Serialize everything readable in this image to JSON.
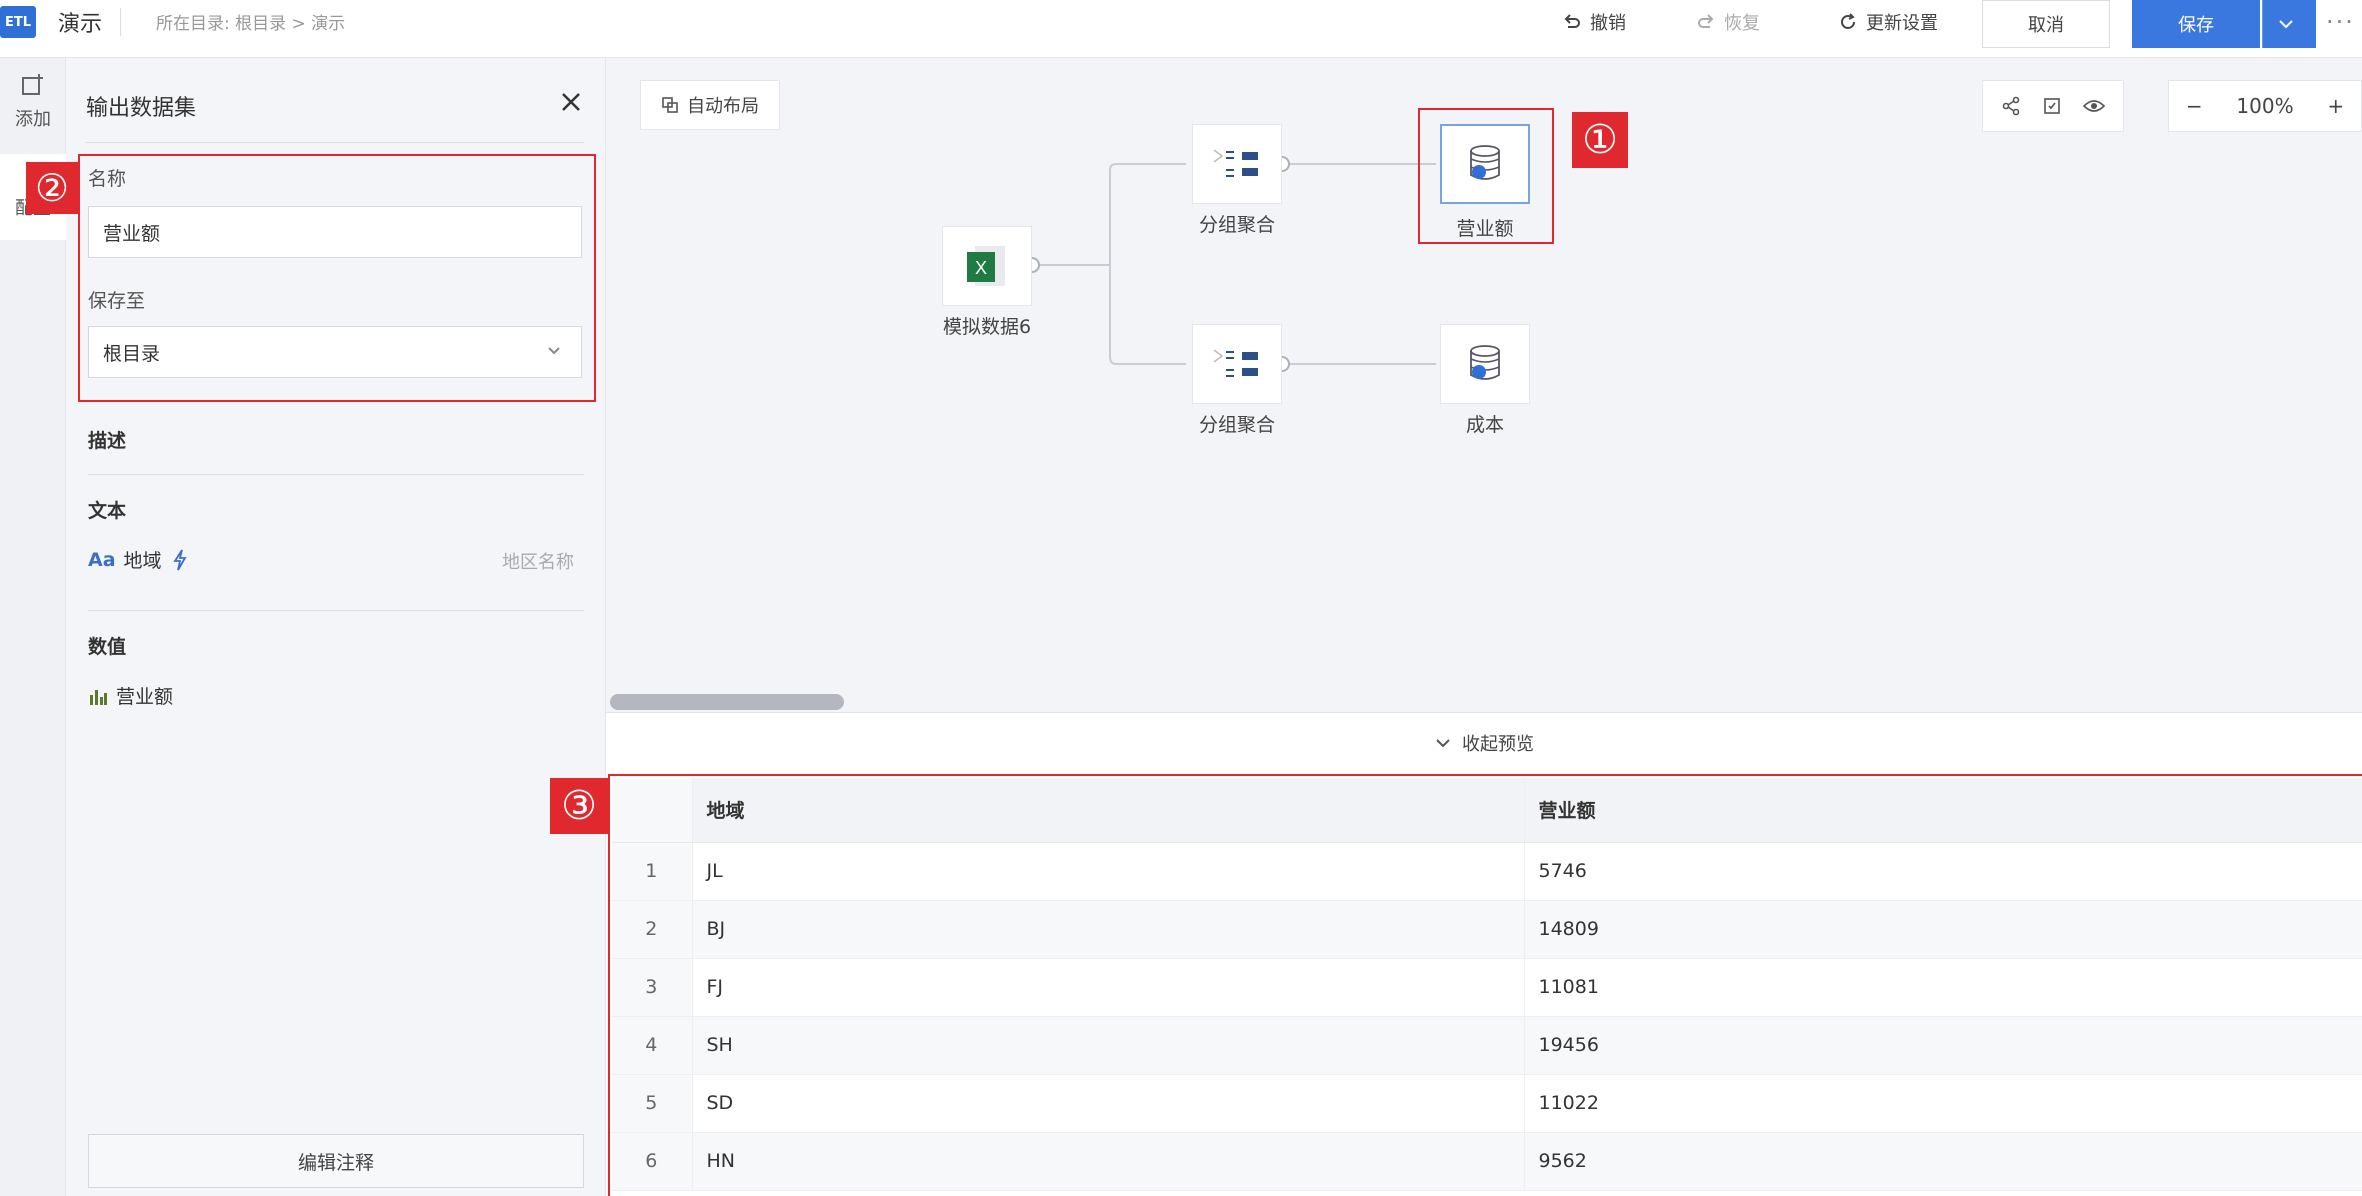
{
  "header": {
    "logo": "ETL",
    "title": "演示",
    "breadcrumb": "所在目录: 根目录 > 演示",
    "undo": "撤销",
    "redo": "恢复",
    "update_settings": "更新设置",
    "cancel": "取消",
    "save": "保存",
    "more": "···"
  },
  "sidebar": {
    "add": "添加",
    "config": "配置"
  },
  "panel": {
    "title": "输出数据集",
    "name_label": "名称",
    "name_value": "营业额",
    "save_to_label": "保存至",
    "save_to_value": "根目录",
    "desc_label": "描述",
    "text_section": "文本",
    "text_field": {
      "type_icon": "Aa",
      "name": "地域",
      "alias": "地区名称"
    },
    "num_section": "数值",
    "num_field": {
      "name": "营业额"
    },
    "edit_note": "编辑注释"
  },
  "canvas": {
    "auto_layout": "自动布局",
    "zoom": "100%",
    "nodes": {
      "source": "模拟数据6",
      "agg1": "分组聚合",
      "agg2": "分组聚合",
      "out1": "营业额",
      "out2": "成本"
    }
  },
  "markers": {
    "m1": "①",
    "m2": "②",
    "m3": "③"
  },
  "preview": {
    "collapse": "收起预览",
    "columns": [
      "地域",
      "营业额"
    ],
    "rows": [
      {
        "idx": "1",
        "region": "JL",
        "revenue": "5746"
      },
      {
        "idx": "2",
        "region": "BJ",
        "revenue": "14809"
      },
      {
        "idx": "3",
        "region": "FJ",
        "revenue": "11081"
      },
      {
        "idx": "4",
        "region": "SH",
        "revenue": "19456"
      },
      {
        "idx": "5",
        "region": "SD",
        "revenue": "11022"
      },
      {
        "idx": "6",
        "region": "HN",
        "revenue": "9562"
      }
    ]
  },
  "colors": {
    "accent": "#3a78e0",
    "highlight": "#e0282f",
    "excel": "#1f7a43"
  }
}
